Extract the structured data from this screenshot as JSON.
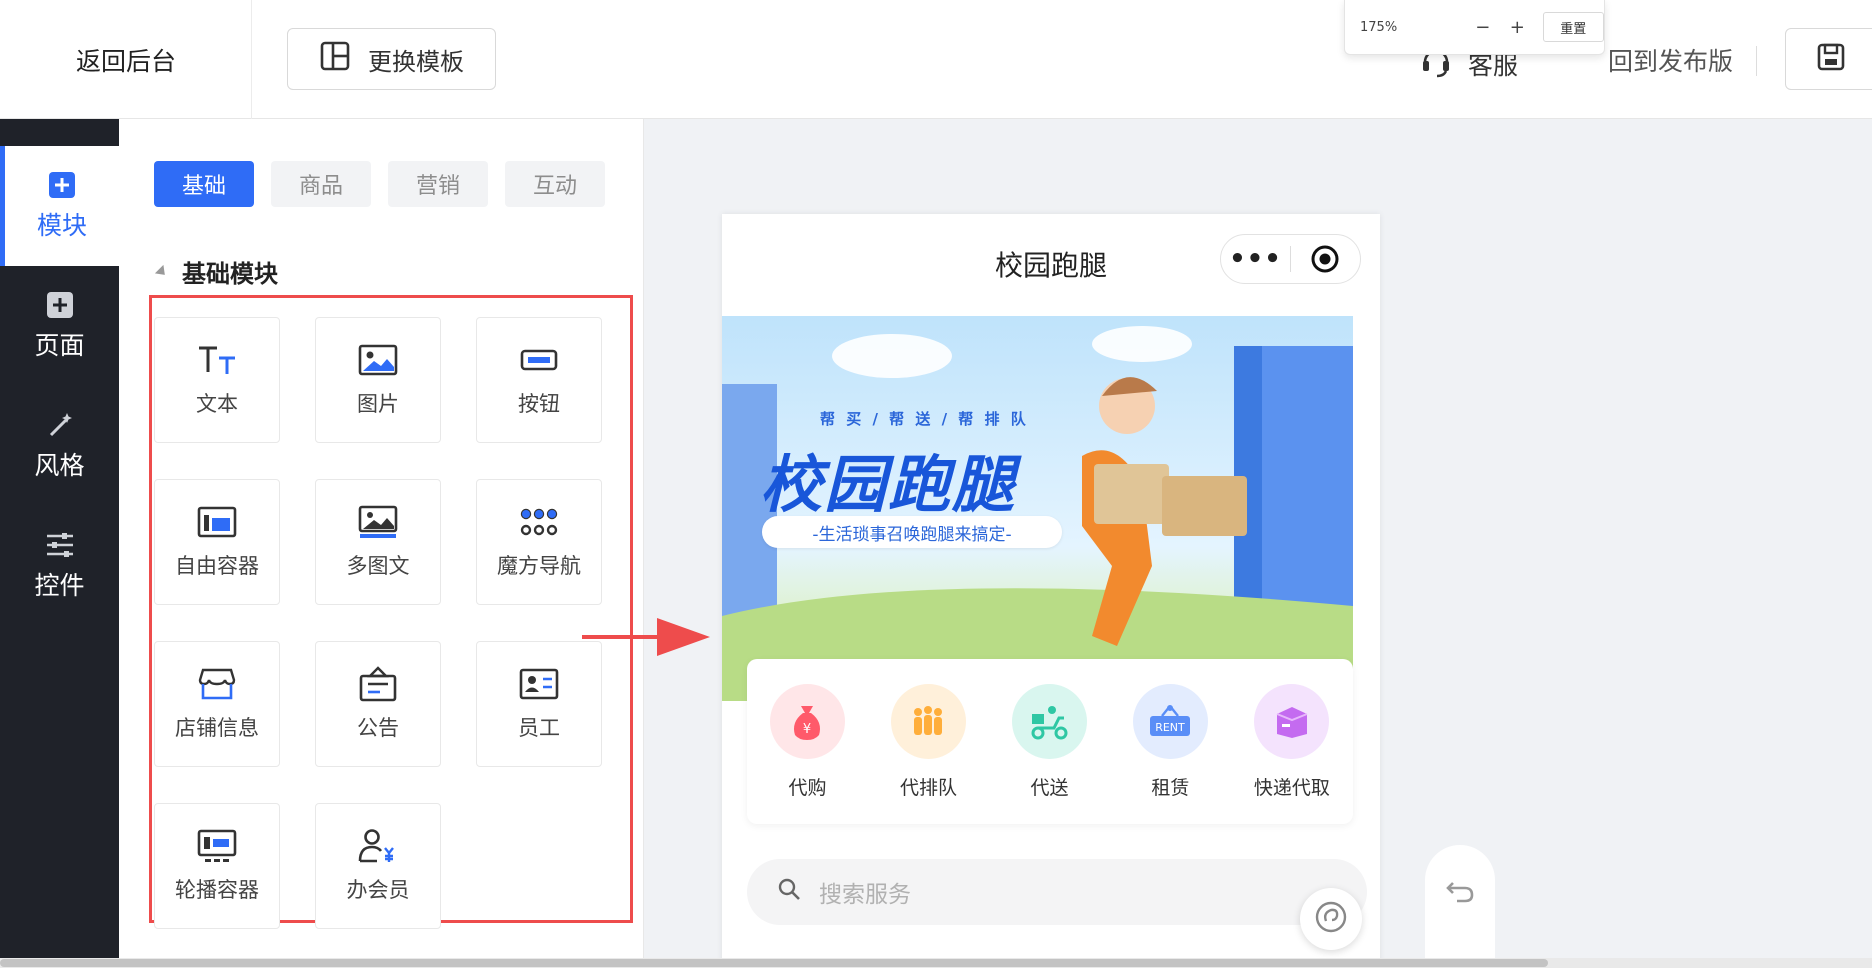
{
  "topbar": {
    "back_label": "返回后台",
    "template_label": "更换模板",
    "zoom_value": "175%",
    "zoom_minus": "−",
    "zoom_plus": "+",
    "zoom_reset": "重置",
    "service_label": "客服",
    "publish_label": "回到发布版"
  },
  "leftnav": {
    "items": [
      {
        "label": "模块",
        "icon": "plus-square-icon"
      },
      {
        "label": "页面",
        "icon": "plus-square-icon"
      },
      {
        "label": "风格",
        "icon": "magic-wand-icon"
      },
      {
        "label": "控件",
        "icon": "sliders-icon"
      }
    ]
  },
  "panel": {
    "tabs": [
      "基础",
      "商品",
      "营销",
      "互动"
    ],
    "section_title": "基础模块",
    "modules": [
      {
        "label": "文本",
        "icon": "text-icon"
      },
      {
        "label": "图片",
        "icon": "image-icon"
      },
      {
        "label": "按钮",
        "icon": "button-icon"
      },
      {
        "label": "自由容器",
        "icon": "container-icon"
      },
      {
        "label": "多图文",
        "icon": "multi-image-icon"
      },
      {
        "label": "魔方导航",
        "icon": "grid-nav-icon"
      },
      {
        "label": "店铺信息",
        "icon": "shop-icon"
      },
      {
        "label": "公告",
        "icon": "notice-icon"
      },
      {
        "label": "员工",
        "icon": "staff-card-icon"
      },
      {
        "label": "轮播容器",
        "icon": "carousel-icon"
      },
      {
        "label": "办会员",
        "icon": "member-icon"
      }
    ]
  },
  "phone": {
    "title": "校园跑腿",
    "banner": {
      "subtitle": "帮 买 / 帮 送 / 帮 排 队",
      "title": "校园跑腿",
      "slogan": "-生活琐事召唤跑腿来搞定-"
    },
    "services": [
      {
        "label": "代购",
        "color": "#ff5a6a"
      },
      {
        "label": "代排队",
        "color": "#ffae3a"
      },
      {
        "label": "代送",
        "color": "#2fc7a4"
      },
      {
        "label": "租赁",
        "color": "#5a8ef7"
      },
      {
        "label": "快递代取",
        "color": "#c46bf0"
      }
    ],
    "search_placeholder": "搜索服务"
  },
  "colors": {
    "accent": "#2f6cf6",
    "nav_bg": "#1f2229",
    "highlight_red": "#ee4c4c"
  }
}
